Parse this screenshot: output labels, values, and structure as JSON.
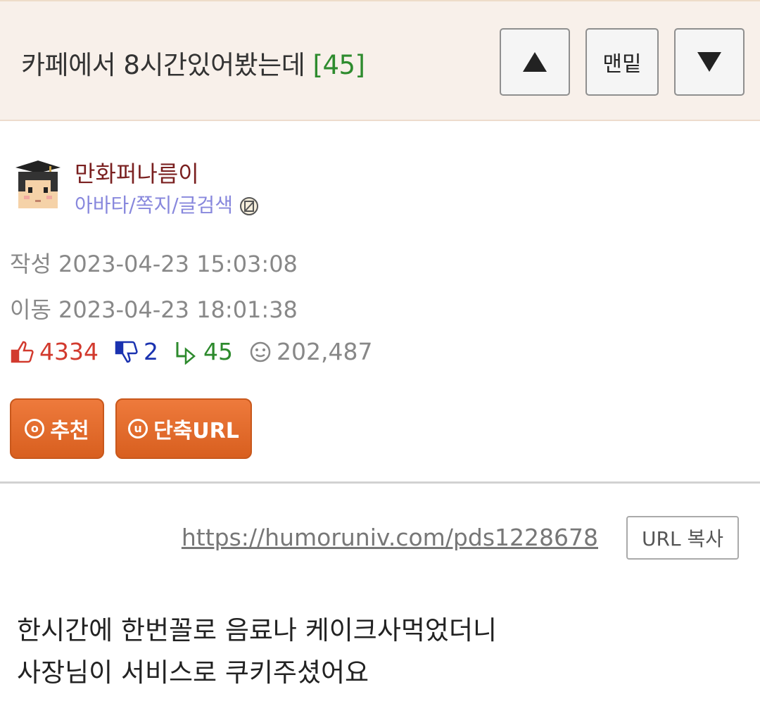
{
  "post": {
    "title": "카페에서 8시간있어봤는데",
    "comment_count": "[45]"
  },
  "nav": {
    "bottom_label": "맨밑",
    "up_icon": "triangle-up-icon",
    "down_icon": "triangle-down-icon"
  },
  "author": {
    "name": "만화퍼나름이",
    "links": "아바타/쪽지/글검색"
  },
  "meta": {
    "created": "작성 2023-04-23 15:03:08",
    "moved": "이동 2023-04-23 18:01:38"
  },
  "stats": {
    "upvotes": "4334",
    "downvotes": "2",
    "replies": "45",
    "views": "202,487"
  },
  "buttons": {
    "recommend": "추천",
    "recommend_icon_glyph": "o",
    "short_url": "단축URL",
    "short_url_icon_glyph": "u"
  },
  "url": {
    "link": "https://humoruniv.com/pds1228678",
    "copy_label": "URL 복사"
  },
  "content": {
    "line1": "한시간에 한번꼴로 음료나 케이크사먹었더니",
    "line2": "사장님이 서비스로 쿠키주셨어요"
  },
  "colors": {
    "header_bg": "#f8f0ea",
    "comment_count": "#2e8b2e",
    "author_name": "#7a2020",
    "author_links": "#8888dd",
    "upvote": "#d23a2e",
    "downvote": "#1a32b0",
    "reply": "#2d8a2d",
    "button_orange": "#e06a2a"
  }
}
